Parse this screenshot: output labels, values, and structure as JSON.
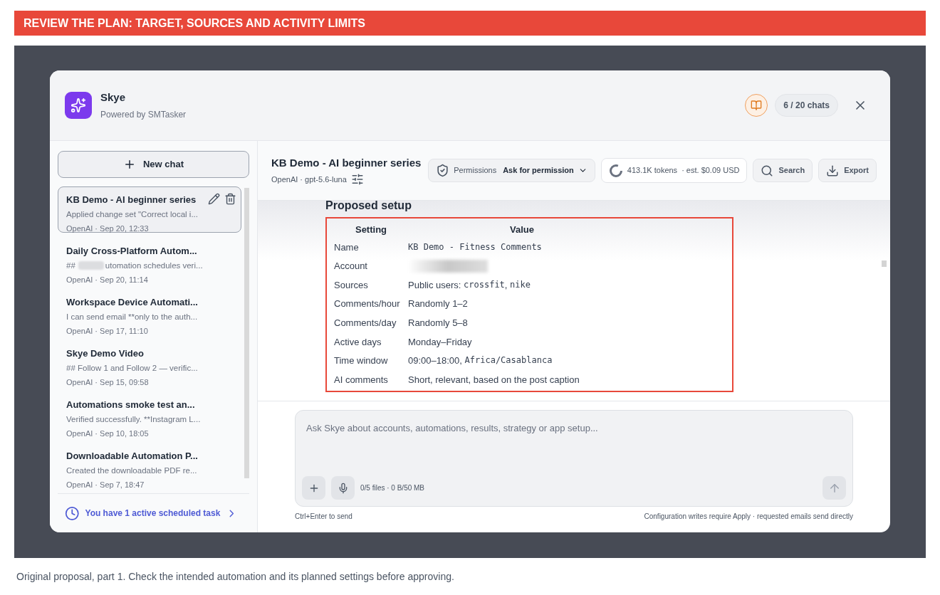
{
  "banner": "REVIEW THE PLAN: TARGET, SOURCES AND ACTIVITY LIMITS",
  "app": {
    "name": "Skye",
    "subtitle": "Powered by SMTasker",
    "counter": "6 / 20 chats"
  },
  "sidebar": {
    "new_chat": "New chat",
    "chats": [
      {
        "title": "KB Demo - AI beginner series",
        "preview": "Applied change set \"Correct local i...",
        "meta": "OpenAI · Sep 20, 12:33",
        "selected": true
      },
      {
        "title": "Daily Cross-Platform Autom...",
        "prefix": "##",
        "redacted": true,
        "preview": "utomation schedules veri...",
        "meta": "OpenAI · Sep 20, 11:14",
        "selected": false
      },
      {
        "title": "Workspace Device Automati...",
        "preview": "I can send email **only to the auth...",
        "meta": "OpenAI · Sep 17, 11:10",
        "selected": false
      },
      {
        "title": "Skye Demo Video",
        "preview": "## Follow 1 and Follow 2 — verific...",
        "meta": "OpenAI · Sep 15, 09:58",
        "selected": false
      },
      {
        "title": "Automations smoke test an...",
        "preview": "Verified successfully. **Instagram L...",
        "meta": "OpenAI · Sep 10, 18:05",
        "selected": false
      },
      {
        "title": "Downloadable Automation P...",
        "preview": "Created the downloadable PDF re...",
        "meta": "OpenAI · Sep 7, 18:47",
        "selected": false
      }
    ],
    "scheduled": "You have 1 active scheduled task"
  },
  "chat": {
    "title": "KB Demo - AI beginner series",
    "provider": "OpenAI · gpt-5.6-luna",
    "permissions_label": "Permissions",
    "permissions_value": "Ask for permission",
    "tokens": "413.1K tokens",
    "cost": "· est. $0.09 USD",
    "search": "Search",
    "export": "Export"
  },
  "content": {
    "heading": "Proposed setup",
    "columns": [
      "Setting",
      "Value"
    ],
    "rows": [
      {
        "setting": "Name",
        "value": [
          {
            "text": "KB Demo - Fitness Comments",
            "code": true
          }
        ]
      },
      {
        "setting": "Account",
        "redacted": true,
        "value": []
      },
      {
        "setting": "Sources",
        "value": [
          {
            "text": "Public users: ",
            "code": false
          },
          {
            "text": "crossfit",
            "code": true
          },
          {
            "text": ", ",
            "code": false
          },
          {
            "text": "nike",
            "code": true
          }
        ]
      },
      {
        "setting": "Comments/hour",
        "value": [
          {
            "text": "Randomly 1–2",
            "code": false
          }
        ]
      },
      {
        "setting": "Comments/day",
        "value": [
          {
            "text": "Randomly 5–8",
            "code": false
          }
        ]
      },
      {
        "setting": "Active days",
        "value": [
          {
            "text": "Monday–Friday",
            "code": false
          }
        ]
      },
      {
        "setting": "Time window",
        "value": [
          {
            "text": "09:00–18:00, ",
            "code": false
          },
          {
            "text": "Africa/Casablanca",
            "code": true
          }
        ]
      },
      {
        "setting": "AI comments",
        "value": [
          {
            "text": "Short, relevant, based on the post caption",
            "code": false
          }
        ]
      }
    ]
  },
  "composer": {
    "placeholder": "Ask Skye about accounts, automations, results, strategy or app setup...",
    "files": "0/5 files · 0 B/50 MB",
    "hint_left": "Ctrl+Enter to send",
    "hint_right": "Configuration writes require Apply · requested emails send directly"
  },
  "caption": "Original proposal, part 1. Check the intended automation and its planned settings before approving."
}
